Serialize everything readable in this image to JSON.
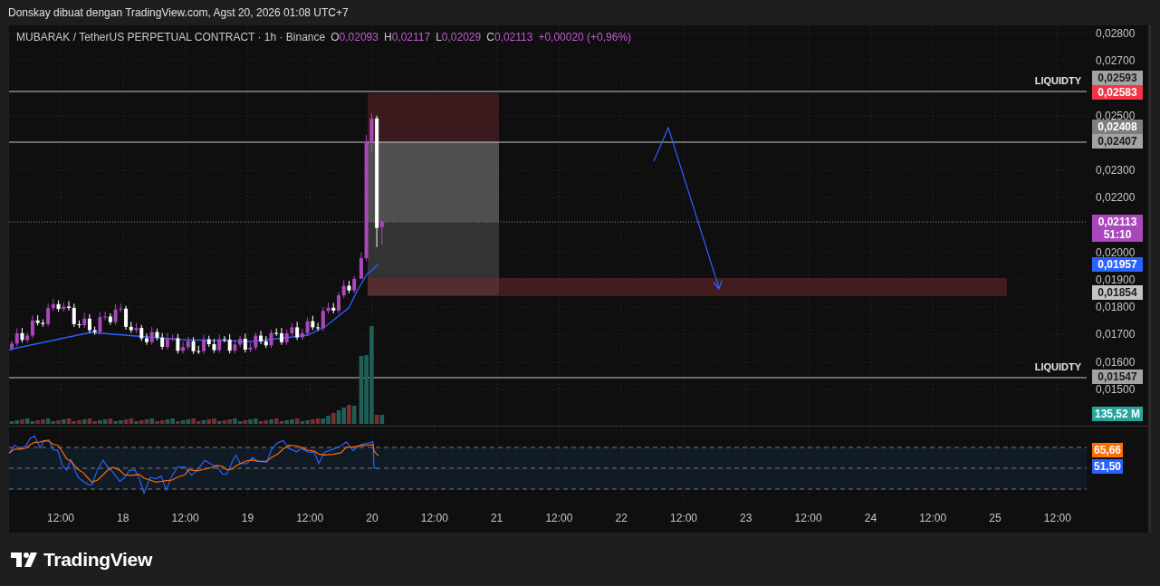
{
  "header": {
    "caption": "Donskay dibuat dengan TradingView.com, Agst 20, 2026 01:08 UTC+7"
  },
  "legend": {
    "symbol": "MUBARAK / TetherUS PERPETUAL CONTRACT · 1h · Binance",
    "ohlc": [
      {
        "label": "O",
        "value": "0,02093"
      },
      {
        "label": "H",
        "value": "0,02117"
      },
      {
        "label": "L",
        "value": "0,02029"
      },
      {
        "label": "C",
        "value": "0,02113"
      }
    ],
    "change": "+0,00020 (+0,96%)"
  },
  "chart_labels": [
    "LIQUIDTY",
    "LIQUIDTY"
  ],
  "price_axis": {
    "ticks": [
      "0,02800",
      "0,02700",
      "0,02500",
      "0,02300",
      "0,02200",
      "0,02000",
      "0,01900",
      "0,01800",
      "0,01700",
      "0,01600",
      "0,01500"
    ],
    "badges": [
      {
        "text": "0,02593",
        "color": "#a3a3a3"
      },
      {
        "text": "0,02583",
        "color": "#f23645"
      },
      {
        "text": "0,02408",
        "color": "#7e7e7e"
      },
      {
        "text": "0,02407",
        "color": "#a3a3a3"
      },
      {
        "text": "0,02113",
        "sub": "51:10",
        "color": "#ab47bc"
      },
      {
        "text": "0,01957",
        "color": "#2962ff"
      },
      {
        "text": "0,01854",
        "color": "#c4c4c4"
      },
      {
        "text": "0,01547",
        "color": "#a3a3a3"
      },
      {
        "text": "135,52 M",
        "color": "#26a69a"
      }
    ]
  },
  "rsi": {
    "badges": [
      {
        "text": "65,66",
        "color": "#ff6d00"
      },
      {
        "text": "51,50",
        "color": "#2962ff"
      }
    ]
  },
  "time_axis": [
    "12:00",
    "18",
    "12:00",
    "19",
    "12:00",
    "20",
    "12:00",
    "21",
    "12:00",
    "22",
    "12:00",
    "23",
    "12:00",
    "24",
    "12:00",
    "25",
    "12:00"
  ],
  "brand": "TradingView"
}
